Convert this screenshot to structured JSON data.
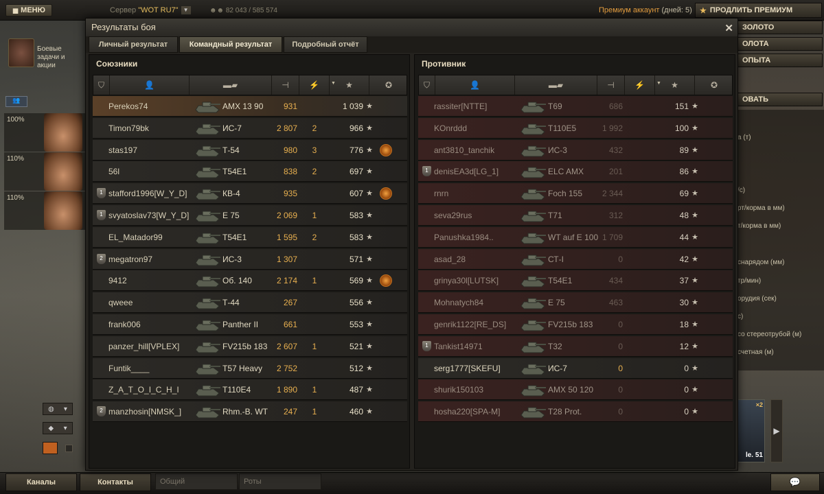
{
  "topbar": {
    "menu_label": "МЕНЮ",
    "server_prefix": "Сервер",
    "server_name": "\"WOT RU7\"",
    "online": "82 043 / 585 574",
    "premium_text": "Премиум аккаунт",
    "premium_days": "(дней:  5)",
    "prolong_label": "ПРОДЛИТЬ ПРЕМИУМ"
  },
  "right_buttons": [
    "ЗОЛОТО",
    "ОЛОТА",
    "ОПЫТА",
    "ОВАТЬ"
  ],
  "right_panel_lines": [
    "а (т)",
    "/c)",
    "рт/корма в мм)",
    "т/корма в мм)",
    "снарядом (мм)",
    "тр/мин)",
    "орудия (сек)",
    "с)",
    "со стереотрубой (м)",
    "счетная (м)"
  ],
  "left": {
    "missions_text": "Боевые задачи и акции",
    "crew": [
      {
        "pct": "100%"
      },
      {
        "pct": "110%"
      },
      {
        "pct": "110%"
      }
    ]
  },
  "bottom": {
    "channels": "Каналы",
    "contacts": "Контакты",
    "general": "Общий",
    "companies": "Роты"
  },
  "tank_card": {
    "x2": "×2",
    "name": "le. 51"
  },
  "dialog": {
    "title": "Результаты боя",
    "tabs": [
      "Личный результат",
      "Командный результат",
      "Подробный отчёт"
    ],
    "ally_title": "Союзники",
    "enemy_title": "Противник",
    "allies": [
      {
        "name": "Perekos74",
        "tank": "AMX 13 90",
        "dmg": "931",
        "kills": "",
        "xp": "1 039",
        "medal": false,
        "badge": ""
      },
      {
        "name": "Timon79bk",
        "tank": "ИС-7",
        "dmg": "2 807",
        "kills": "2",
        "xp": "966",
        "medal": false,
        "badge": ""
      },
      {
        "name": "stas197",
        "tank": "Т-54",
        "dmg": "980",
        "kills": "3",
        "xp": "776",
        "medal": true,
        "badge": ""
      },
      {
        "name": "56l",
        "tank": "T54E1",
        "dmg": "838",
        "kills": "2",
        "xp": "697",
        "medal": false,
        "badge": ""
      },
      {
        "name": "stafford1996[W_Y_D]",
        "tank": "КВ-4",
        "dmg": "935",
        "kills": "",
        "xp": "607",
        "medal": true,
        "badge": "1"
      },
      {
        "name": "svyatoslav73[W_Y_D]",
        "tank": "E 75",
        "dmg": "2 069",
        "kills": "1",
        "xp": "583",
        "medal": false,
        "badge": "1"
      },
      {
        "name": "EL_Matador99",
        "tank": "T54E1",
        "dmg": "1 595",
        "kills": "2",
        "xp": "583",
        "medal": false,
        "badge": ""
      },
      {
        "name": "megatron97",
        "tank": "ИС-3",
        "dmg": "1 307",
        "kills": "",
        "xp": "571",
        "medal": false,
        "badge": "2"
      },
      {
        "name": "9412",
        "tank": "Об. 140",
        "dmg": "2 174",
        "kills": "1",
        "xp": "569",
        "medal": true,
        "badge": ""
      },
      {
        "name": "qweee",
        "tank": "Т-44",
        "dmg": "267",
        "kills": "",
        "xp": "556",
        "medal": false,
        "badge": ""
      },
      {
        "name": "frank006",
        "tank": "Panther II",
        "dmg": "661",
        "kills": "",
        "xp": "553",
        "medal": false,
        "badge": ""
      },
      {
        "name": "panzer_hill[VPLEX]",
        "tank": "FV215b 183",
        "dmg": "2 607",
        "kills": "1",
        "xp": "521",
        "medal": false,
        "badge": ""
      },
      {
        "name": "Funtik____",
        "tank": "T57 Heavy",
        "dmg": "2 752",
        "kills": "",
        "xp": "512",
        "medal": false,
        "badge": ""
      },
      {
        "name": "Z_A_T_O_I_C_H_I",
        "tank": "T110E4",
        "dmg": "1 890",
        "kills": "1",
        "xp": "487",
        "medal": false,
        "badge": ""
      },
      {
        "name": "manzhosin[NMSK_]",
        "tank": "Rhm.-B. WT",
        "dmg": "247",
        "kills": "1",
        "xp": "460",
        "medal": false,
        "badge": "2"
      }
    ],
    "enemies": [
      {
        "name": "rassiter[NTTE]",
        "tank": "T69",
        "dmg": "686",
        "kills": "",
        "xp": "151",
        "alive": false,
        "badge": ""
      },
      {
        "name": "KOnrddd",
        "tank": "T110E5",
        "dmg": "1 992",
        "kills": "",
        "xp": "100",
        "alive": false,
        "badge": ""
      },
      {
        "name": "ant3810_tanchik",
        "tank": "ИС-3",
        "dmg": "432",
        "kills": "",
        "xp": "89",
        "alive": false,
        "badge": ""
      },
      {
        "name": "denisEA3d[LG_1]",
        "tank": "ELC AMX",
        "dmg": "201",
        "kills": "",
        "xp": "86",
        "alive": false,
        "badge": "1"
      },
      {
        "name": "rnrn",
        "tank": "Foch 155",
        "dmg": "2 344",
        "kills": "",
        "xp": "69",
        "alive": false,
        "badge": ""
      },
      {
        "name": "seva29rus",
        "tank": "T71",
        "dmg": "312",
        "kills": "",
        "xp": "48",
        "alive": false,
        "badge": ""
      },
      {
        "name": "Panushka1984..",
        "tank": "WT auf E 100",
        "dmg": "1 709",
        "kills": "",
        "xp": "44",
        "alive": false,
        "badge": ""
      },
      {
        "name": "asad_28",
        "tank": "СТ-I",
        "dmg": "0",
        "kills": "",
        "xp": "42",
        "alive": false,
        "badge": ""
      },
      {
        "name": "grinya30l[LUTSK]",
        "tank": "T54E1",
        "dmg": "434",
        "kills": "",
        "xp": "37",
        "alive": false,
        "badge": ""
      },
      {
        "name": "Mohnatych84",
        "tank": "E 75",
        "dmg": "463",
        "kills": "",
        "xp": "30",
        "alive": false,
        "badge": ""
      },
      {
        "name": "genrik1122[RE_DS]",
        "tank": "FV215b 183",
        "dmg": "0",
        "kills": "",
        "xp": "18",
        "alive": false,
        "badge": ""
      },
      {
        "name": "Tankist14971",
        "tank": "T32",
        "dmg": "0",
        "kills": "",
        "xp": "12",
        "alive": false,
        "badge": "1"
      },
      {
        "name": "serg1777[SKEFU]",
        "tank": "ИС-7",
        "dmg": "0",
        "kills": "",
        "xp": "0",
        "alive": true,
        "badge": ""
      },
      {
        "name": "shurik150103",
        "tank": "AMX 50 120",
        "dmg": "0",
        "kills": "",
        "xp": "0",
        "alive": false,
        "badge": ""
      },
      {
        "name": "hosha220[SPA-M]",
        "tank": "T28 Prot.",
        "dmg": "0",
        "kills": "",
        "xp": "0",
        "alive": false,
        "badge": ""
      }
    ]
  }
}
